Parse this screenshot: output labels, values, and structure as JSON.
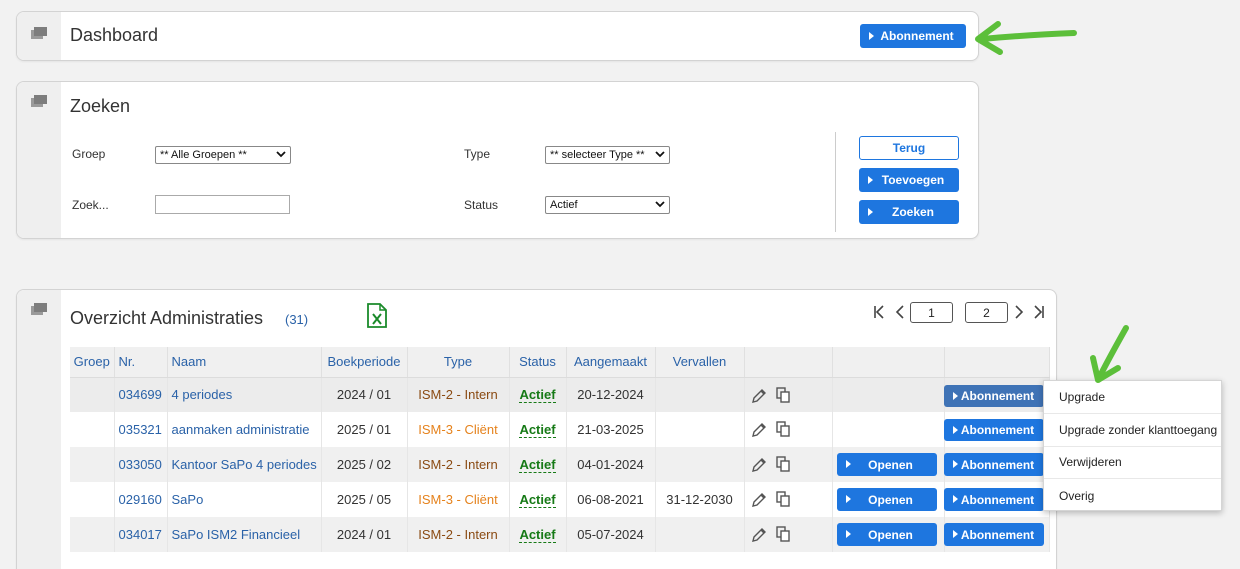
{
  "dashboard": {
    "title": "Dashboard",
    "subscription_button": "Abonnement"
  },
  "search": {
    "title": "Zoeken",
    "group_label": "Groep",
    "group_value": "** Alle Groepen **",
    "search_label": "Zoek...",
    "search_value": "",
    "type_label": "Type",
    "type_value": "** selecteer Type **",
    "status_label": "Status",
    "status_value": "Actief",
    "back_button": "Terug",
    "add_button": "Toevoegen",
    "search_button": "Zoeken"
  },
  "overview": {
    "title": "Overzicht Administraties",
    "count": "(31)",
    "excel_icon": "excel-export-icon",
    "page_current": "1",
    "page_total": "2",
    "columns": [
      "Groep",
      "Nr.",
      "Naam",
      "Boekperiode",
      "Type",
      "Status",
      "Aangemaakt",
      "Vervallen"
    ],
    "open_label": "Openen",
    "subscription_label": "Abonnement",
    "rows": [
      {
        "groep": "",
        "nr": "034699",
        "naam": "4 periodes",
        "boekperiode": "2024 / 01",
        "type": "ISM-2 - Intern",
        "status": "Actief",
        "aangemaakt": "20-12-2024",
        "vervallen": ""
      },
      {
        "groep": "",
        "nr": "035321",
        "naam": "aanmaken administratie",
        "boekperiode": "2025 / 01",
        "type": "ISM-3 - Cliënt",
        "status": "Actief",
        "aangemaakt": "21-03-2025",
        "vervallen": ""
      },
      {
        "groep": "",
        "nr": "033050",
        "naam": "Kantoor SaPo 4 periodes",
        "boekperiode": "2025 / 02",
        "type": "ISM-2 - Intern",
        "status": "Actief",
        "aangemaakt": "04-01-2024",
        "vervallen": ""
      },
      {
        "groep": "",
        "nr": "029160",
        "naam": "SaPo",
        "boekperiode": "2025 / 05",
        "type": "ISM-3 - Cliënt",
        "status": "Actief",
        "aangemaakt": "06-08-2021",
        "vervallen": "31-12-2030"
      },
      {
        "groep": "",
        "nr": "034017",
        "naam": "SaPo ISM2 Financieel",
        "boekperiode": "2024 / 01",
        "type": "ISM-2 - Intern",
        "status": "Actief",
        "aangemaakt": "05-07-2024",
        "vervallen": ""
      }
    ]
  },
  "context_menu": {
    "items": [
      "Upgrade",
      "Upgrade zonder klanttoegang",
      "Verwijderen",
      "Overig"
    ]
  },
  "colors": {
    "accent": "#1e76df",
    "link": "#2a62a8",
    "status_active": "#167a16",
    "arrow": "#5cbf3a"
  }
}
